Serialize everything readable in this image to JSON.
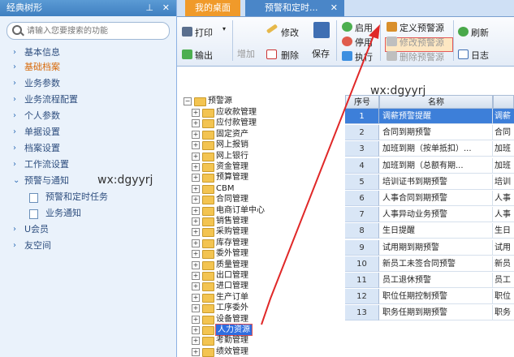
{
  "sidebar": {
    "title": "经典树形",
    "search_placeholder": "请输入您要搜索的功能",
    "items": [
      {
        "label": "基本信息"
      },
      {
        "label": "基础档案"
      },
      {
        "label": "业务参数"
      },
      {
        "label": "业务流程配置"
      },
      {
        "label": "个人参数"
      },
      {
        "label": "单据设置"
      },
      {
        "label": "档案设置"
      },
      {
        "label": "工作流设置"
      },
      {
        "label": "预警与通知"
      },
      {
        "label": "预警和定时任务"
      },
      {
        "label": "业务通知"
      },
      {
        "label": "U会员"
      },
      {
        "label": "友空间"
      }
    ],
    "watermark": "wx:dgyyrj"
  },
  "tabs": [
    {
      "label": "我的桌面"
    },
    {
      "label": "预警和定时..."
    }
  ],
  "toolbar": {
    "print": "打印",
    "export": "输出",
    "add": "增加",
    "edit": "修改",
    "delete": "删除",
    "save": "保存",
    "enable": "启用",
    "disable": "停用",
    "execute": "执行",
    "define_source": "定义预警源",
    "edit_source": "修改预警源",
    "delete_source": "删除预警源",
    "refresh": "刷新",
    "log": "日志"
  },
  "tree": {
    "root": "预警源",
    "nodes": [
      "应收款管理",
      "应付款管理",
      "固定资产",
      "网上报销",
      "网上银行",
      "资金管理",
      "预算管理",
      "CBM",
      "合同管理",
      "电商订单中心",
      "销售管理",
      "采购管理",
      "库存管理",
      "委外管理",
      "质量管理",
      "出口管理",
      "进口管理",
      "生产订单",
      "工序委外",
      "设备管理",
      "人力资源",
      "考勤管理",
      "绩效管理"
    ],
    "selected": "人力资源"
  },
  "grid": {
    "col_no": "序号",
    "col_name": "名称",
    "col3": "",
    "watermark": "wx:dgyyrj",
    "rows": [
      {
        "no": "1",
        "name": "调薪预警提醒",
        "c3": "调薪"
      },
      {
        "no": "2",
        "name": "合同到期预警",
        "c3": "合同"
      },
      {
        "no": "3",
        "name": "加班到期（按单抵扣）...",
        "c3": "加班"
      },
      {
        "no": "4",
        "name": "加班到期（总额有期...",
        "c3": "加班"
      },
      {
        "no": "5",
        "name": "培训证书到期预警",
        "c3": "培训"
      },
      {
        "no": "6",
        "name": "人事合同到期预警",
        "c3": "人事"
      },
      {
        "no": "7",
        "name": "人事异动业务预警",
        "c3": "人事"
      },
      {
        "no": "8",
        "name": "生日提醒",
        "c3": "生日"
      },
      {
        "no": "9",
        "name": "试用期到期预警",
        "c3": "试用"
      },
      {
        "no": "10",
        "name": "新员工未签合同预警",
        "c3": "新员"
      },
      {
        "no": "11",
        "name": "员工退休预警",
        "c3": "员工"
      },
      {
        "no": "12",
        "name": "职位任期控制预警",
        "c3": "职位"
      },
      {
        "no": "13",
        "name": "职务任期到期预警",
        "c3": "职务"
      }
    ]
  }
}
